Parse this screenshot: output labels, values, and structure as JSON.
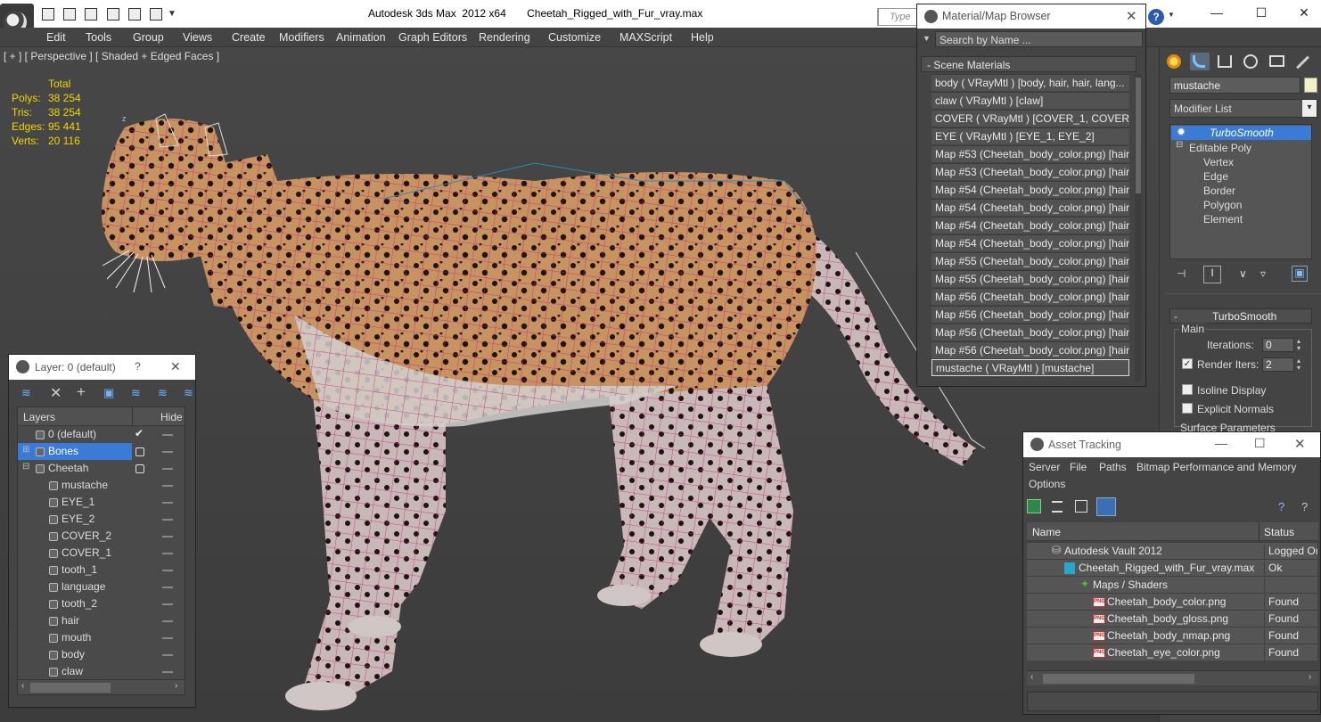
{
  "titlebar": {
    "title": "Autodesk 3ds Max  2012 x64       Cheetah_Rigged_with_Fur_vray.max",
    "search_placeholder": "Type a"
  },
  "menu": [
    "Edit",
    "Tools",
    "Group",
    "Views",
    "Create",
    "Modifiers",
    "Animation",
    "Graph Editors",
    "Rendering",
    "Customize",
    "MAXScript",
    "Help"
  ],
  "viewport": {
    "label": "[ + ] [ Perspective ] [ Shaded + Edged Faces ]",
    "stats_header": "Total",
    "stats": [
      {
        "label": "Polys:",
        "value": "38 254"
      },
      {
        "label": "Tris:",
        "value": "38 254"
      },
      {
        "label": "Edges:",
        "value": "95 441"
      },
      {
        "label": "Verts:",
        "value": "20 116"
      }
    ],
    "axis_label": "z"
  },
  "layer_panel": {
    "title": "Layer: 0 (default)",
    "help": "?",
    "col_layers": "Layers",
    "col_hide": "Hide",
    "rows": [
      "0 (default)",
      "Bones",
      "Cheetah",
      "mustache",
      "EYE_1",
      "EYE_2",
      "COVER_2",
      "COVER_1",
      "tooth_1",
      "language",
      "tooth_2",
      "hair",
      "mouth",
      "body",
      "claw"
    ]
  },
  "material_browser": {
    "title": "Material/Map Browser",
    "search_placeholder": "Search by Name ...",
    "group": "- Scene Materials",
    "items": [
      "body  ( VRayMtl ) [body, hair, hair, lang...",
      "claw  ( VRayMtl ) [claw]",
      "COVER  ( VRayMtl ) [COVER_1, COVER_2]",
      "EYE  ( VRayMtl ) [EYE_1, EYE_2]",
      "Map #53 (Cheetah_body_color.png)  [hair]",
      "Map #53 (Cheetah_body_color.png)  [hair]",
      "Map #54 (Cheetah_body_color.png)  [hair]",
      "Map #54 (Cheetah_body_color.png)  [hair]",
      "Map #54 (Cheetah_body_color.png)  [hair]",
      "Map #54 (Cheetah_body_color.png)  [hair]",
      "Map #55 (Cheetah_body_color.png)  [hair]",
      "Map #55 (Cheetah_body_color.png)  [hair]",
      "Map #56 (Cheetah_body_color.png)  [hair]",
      "Map #56 (Cheetah_body_color.png)  [hair]",
      "Map #56 (Cheetah_body_color.png)  [hair]",
      "Map #56 (Cheetah_body_color.png)  [hair]",
      "mustache  ( VRayMtl ) [mustache]"
    ]
  },
  "command_panel": {
    "object_name": "mustache",
    "modifier_list": "Modifier List",
    "stack": [
      "TurboSmooth",
      "Editable Poly",
      "Vertex",
      "Edge",
      "Border",
      "Polygon",
      "Element"
    ],
    "rollout_title": "TurboSmooth",
    "main_label": "Main",
    "iterations_label": "Iterations:",
    "iterations_value": "0",
    "render_iters_label": "Render Iters:",
    "render_iters_value": "2",
    "isoline_label": "Isoline Display",
    "explicit_label": "Explicit Normals",
    "surface_label": "Surface Parameters"
  },
  "asset_tracking": {
    "title": "Asset Tracking",
    "menu": [
      "Server",
      "File",
      "Paths",
      "Bitmap Performance and Memory",
      "Options"
    ],
    "col_name": "Name",
    "col_status": "Status",
    "rows": [
      {
        "name": "Autodesk Vault 2012",
        "status": "Logged Out",
        "indent": 0
      },
      {
        "name": "Cheetah_Rigged_with_Fur_vray.max",
        "status": "Ok",
        "indent": 1
      },
      {
        "name": "Maps / Shaders",
        "status": "",
        "indent": 2
      },
      {
        "name": "Cheetah_body_color.png",
        "status": "Found",
        "indent": 3
      },
      {
        "name": "Cheetah_body_gloss.png",
        "status": "Found",
        "indent": 3
      },
      {
        "name": "Cheetah_body_nmap.png",
        "status": "Found",
        "indent": 3
      },
      {
        "name": "Cheetah_eye_color.png",
        "status": "Found",
        "indent": 3
      }
    ]
  },
  "colors": {
    "stats": "#f2d600",
    "selection": "#3a7bd5",
    "wire": "#c0287a"
  }
}
